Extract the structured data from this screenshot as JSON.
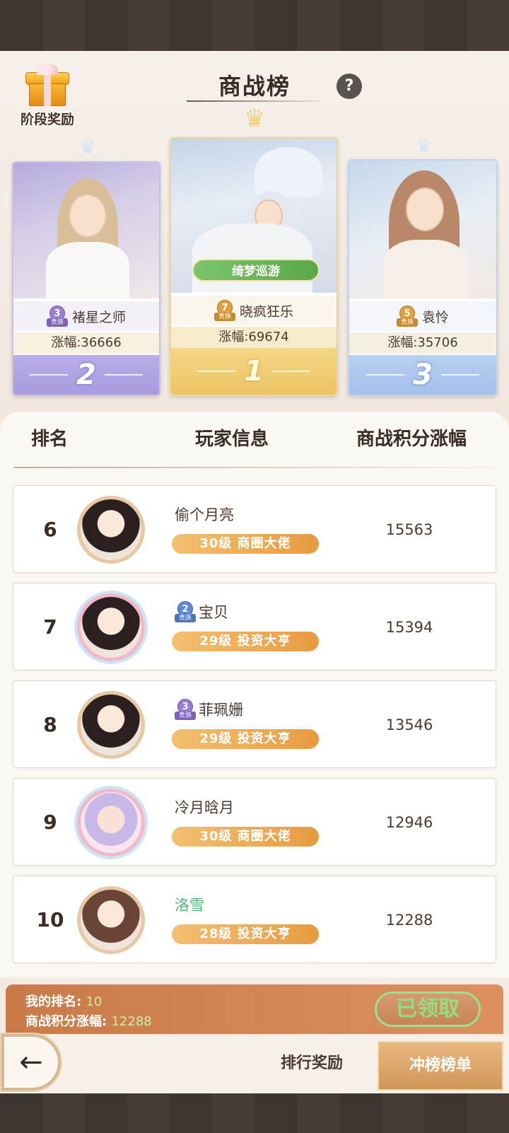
{
  "stage_reward_label": "阶段奖励",
  "title": "商战榜",
  "help_label": "?",
  "podium": {
    "first": {
      "rank": "1",
      "name": "晓疯狂乐",
      "noble_level": "7",
      "noble_tag": "贵族",
      "gain": "涨幅:69674",
      "event_badge": "绮梦巡游"
    },
    "second": {
      "rank": "2",
      "name": "褚星之师",
      "noble_level": "3",
      "noble_tag": "贵族",
      "gain": "涨幅:36666"
    },
    "third": {
      "rank": "3",
      "name": "袁怜",
      "noble_level": "5",
      "noble_tag": "贵族",
      "gain": "涨幅:35706"
    }
  },
  "list_header": {
    "rank": "排名",
    "info": "玩家信息",
    "score": "商战积分涨幅"
  },
  "rows": [
    {
      "rank": "6",
      "name": "偷个月亮",
      "noble_level": "",
      "noble_tag": "",
      "title": "30级 商圈大佬",
      "score": "15563"
    },
    {
      "rank": "7",
      "name": "宝贝",
      "noble_level": "2",
      "noble_tag": "贵族",
      "title": "29级 投资大亨",
      "score": "15394"
    },
    {
      "rank": "8",
      "name": "菲珮姗",
      "noble_level": "3",
      "noble_tag": "贵族",
      "title": "29级 投资大亨",
      "score": "13546"
    },
    {
      "rank": "9",
      "name": "冷月晗月",
      "noble_level": "",
      "noble_tag": "",
      "title": "30级 商圈大佬",
      "score": "12946"
    },
    {
      "rank": "10",
      "name": "洛雪",
      "noble_level": "",
      "noble_tag": "",
      "title": "28级 投资大亨",
      "score": "12288"
    }
  ],
  "my_rank": {
    "rank_label": "我的排名:",
    "rank_value": "10",
    "score_label": "商战积分涨幅:",
    "score_value": "12288",
    "claimed_label": "已领取"
  },
  "nav": {
    "back_icon": "←",
    "reward_tab": "排行奖励",
    "chart_tab": "冲榜榜单"
  }
}
